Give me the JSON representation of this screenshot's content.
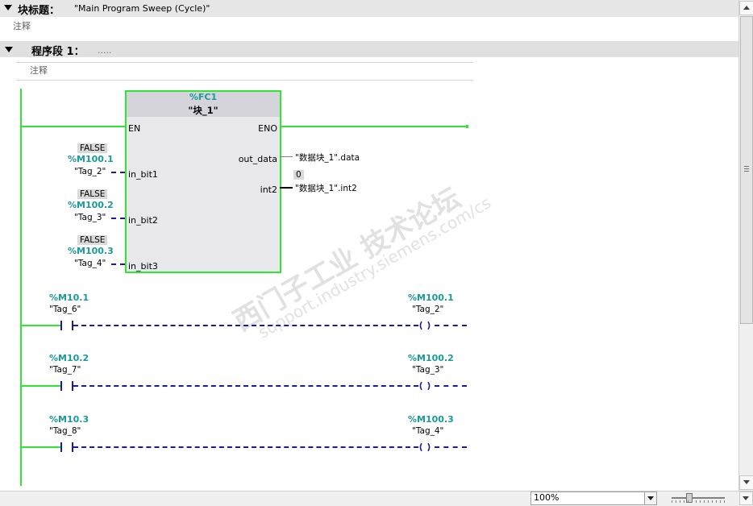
{
  "block": {
    "title_label": "块标题：",
    "title_value": "\"Main Program Sweep (Cycle)\"",
    "comment": "注释"
  },
  "network": {
    "label": "程序段 1：",
    "dots": ".....",
    "comment": "注释"
  },
  "function_block": {
    "address": "%FC1",
    "name": "\"块_1\"",
    "en": "EN",
    "eno": "ENO",
    "inputs": [
      {
        "pin": "in_bit1",
        "value": "FALSE",
        "address": "%M100.1",
        "tag": "\"Tag_2\""
      },
      {
        "pin": "in_bit2",
        "value": "FALSE",
        "address": "%M100.2",
        "tag": "\"Tag_3\""
      },
      {
        "pin": "in_bit3",
        "value": "FALSE",
        "address": "%M100.3",
        "tag": "\"Tag_4\""
      }
    ],
    "outputs": [
      {
        "pin": "out_data",
        "tag": "\"数据块_1\".data",
        "value": ""
      },
      {
        "pin": "int2",
        "tag": "\"数据块_1\".int2",
        "value": "0"
      }
    ]
  },
  "rungs": [
    {
      "contact_address": "%M10.1",
      "contact_tag": "\"Tag_6\"",
      "coil_address": "%M100.1",
      "coil_tag": "\"Tag_2\""
    },
    {
      "contact_address": "%M10.2",
      "contact_tag": "\"Tag_7\"",
      "coil_address": "%M100.2",
      "coil_tag": "\"Tag_3\""
    },
    {
      "contact_address": "%M10.3",
      "contact_tag": "\"Tag_8\"",
      "coil_address": "%M100.3",
      "coil_tag": "\"Tag_4\""
    }
  ],
  "watermark": {
    "line1": "西门子工业 技术论坛",
    "line2": "support.industry.siemens.com/cs"
  },
  "statusbar": {
    "zoom": "100%"
  },
  "colors": {
    "power_rail": "#33e433",
    "address_teal": "#1a9a9a",
    "dashed_wire": "#1a1a9a",
    "block_fill": "#e8e8ec"
  }
}
